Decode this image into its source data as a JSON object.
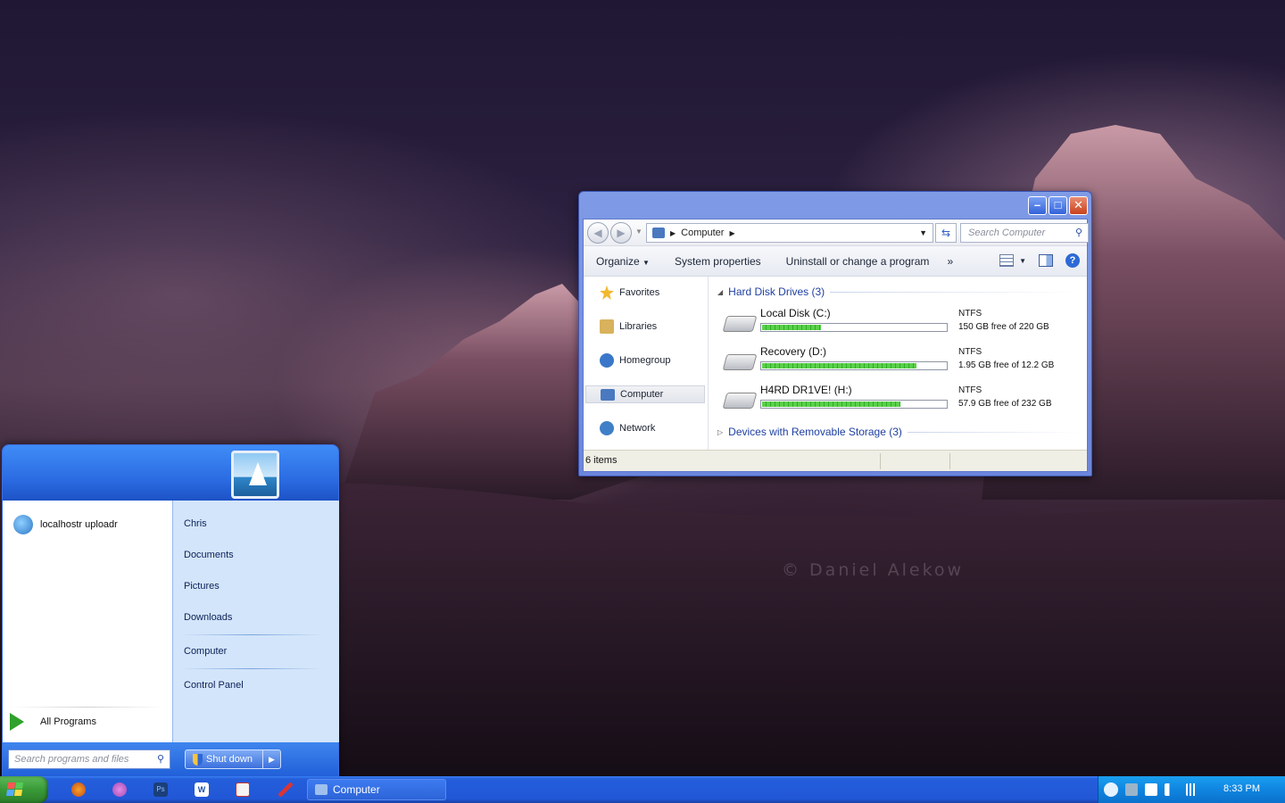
{
  "desktop": {
    "watermark": "© Daniel Alekow"
  },
  "explorer": {
    "address": {
      "segment": "Computer",
      "search_placeholder": "Search Computer"
    },
    "toolbar": {
      "organize": "Organize",
      "system_properties": "System properties",
      "uninstall": "Uninstall or change a program",
      "more": "»"
    },
    "nav": [
      {
        "label": "Favorites",
        "icon": "star-icon",
        "color": "#f2b82f"
      },
      {
        "label": "Libraries",
        "icon": "library-icon",
        "color": "#d8b25c"
      },
      {
        "label": "Homegroup",
        "icon": "homegroup-icon",
        "color": "#3a77c9"
      },
      {
        "label": "Computer",
        "icon": "computer-icon",
        "color": "#4a79c0"
      },
      {
        "label": "Network",
        "icon": "network-icon",
        "color": "#3f7fc8"
      }
    ],
    "groups": {
      "hdd": "Hard Disk Drives (3)",
      "removable": "Devices with Removable Storage (3)"
    },
    "drives": [
      {
        "name": "Local Disk (C:)",
        "fs": "NTFS",
        "free": "150 GB free of 220 GB",
        "used_fraction": 0.32
      },
      {
        "name": "Recovery (D:)",
        "fs": "NTFS",
        "free": "1.95 GB free of 12.2 GB",
        "used_fraction": 0.84
      },
      {
        "name": "H4RD DR1VE! (H:)",
        "fs": "NTFS",
        "free": "57.9 GB free of 232 GB",
        "used_fraction": 0.75
      }
    ],
    "status": "6 items"
  },
  "start_menu": {
    "pinned": "localhostr uploadr",
    "all_programs": "All Programs",
    "right_items": [
      "Chris",
      "Documents",
      "Pictures",
      "Downloads",
      "Computer",
      "Control Panel"
    ],
    "search_placeholder": "Search programs and files",
    "shutdown": "Shut down"
  },
  "taskbar": {
    "active_window": "Computer",
    "clock": "8:33 PM",
    "quick_launch": [
      "firefox-icon",
      "pinwheel-icon",
      "photoshop-icon",
      "word-icon",
      "app-icon",
      "tools-icon"
    ]
  }
}
